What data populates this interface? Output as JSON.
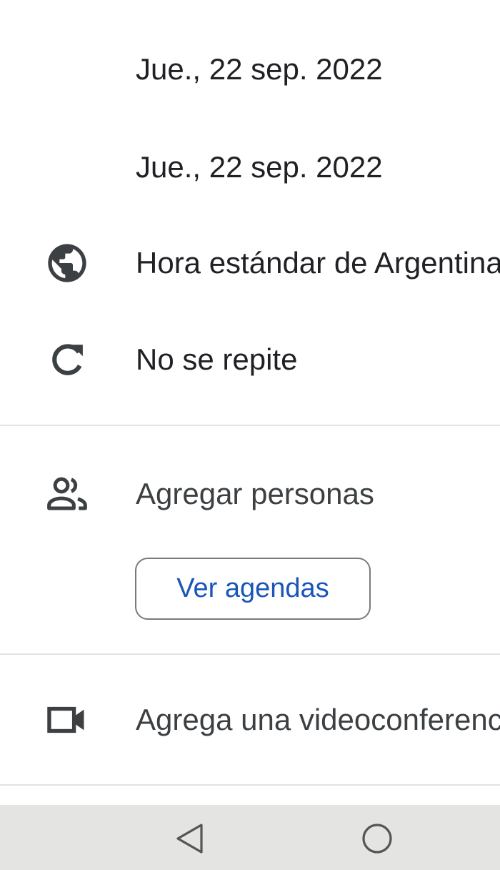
{
  "event": {
    "start_date": "Jue., 22 sep. 2022",
    "end_date": "Jue., 22 sep. 2022",
    "timezone": "Hora estándar de Argentina",
    "repeat": "No se repite",
    "add_people": "Agregar personas",
    "view_schedules_button": "Ver agendas",
    "add_videoconference": "Agrega una videoconferencia"
  },
  "icons": {
    "timezone": "globe-icon",
    "repeat": "repeat-icon",
    "people": "people-icon",
    "video": "video-camera-icon",
    "nav_back": "back-triangle-icon",
    "nav_home": "home-circle-icon"
  },
  "colors": {
    "button_text": "#1a56b8",
    "text": "#202124",
    "divider": "#e3e3e3",
    "navbar": "#e4e4e2"
  }
}
